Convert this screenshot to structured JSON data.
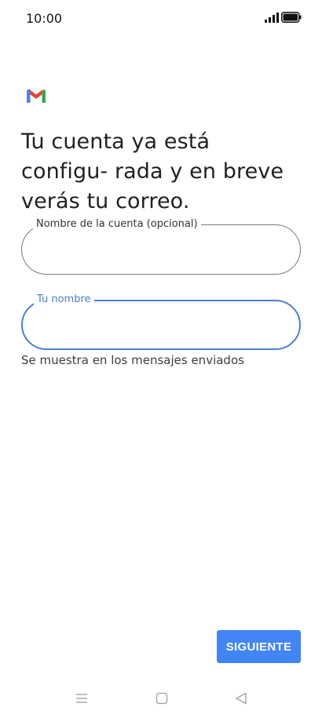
{
  "status_bar": {
    "time": "10:00",
    "icons": [
      "signal-icon",
      "battery-icon"
    ]
  },
  "app": {
    "logo": "gmail-logo-icon",
    "colors": {
      "accent": "#4285f4",
      "focus_outline": "#4a7fd4",
      "text": "#202124"
    }
  },
  "main": {
    "headline": "Tu cuenta ya está configu- rada y en breve verás tu correo.",
    "account_field": {
      "label": "Nombre de la cuenta (opcional)",
      "value": ""
    },
    "name_field": {
      "label": "Tu nombre",
      "value": "",
      "helper": "Se muestra en los mensajes enviados"
    }
  },
  "footer": {
    "next_label": "SIGUIENTE"
  },
  "nav_bar": {
    "icons": [
      "menu-icon",
      "home-icon",
      "back-icon"
    ]
  }
}
